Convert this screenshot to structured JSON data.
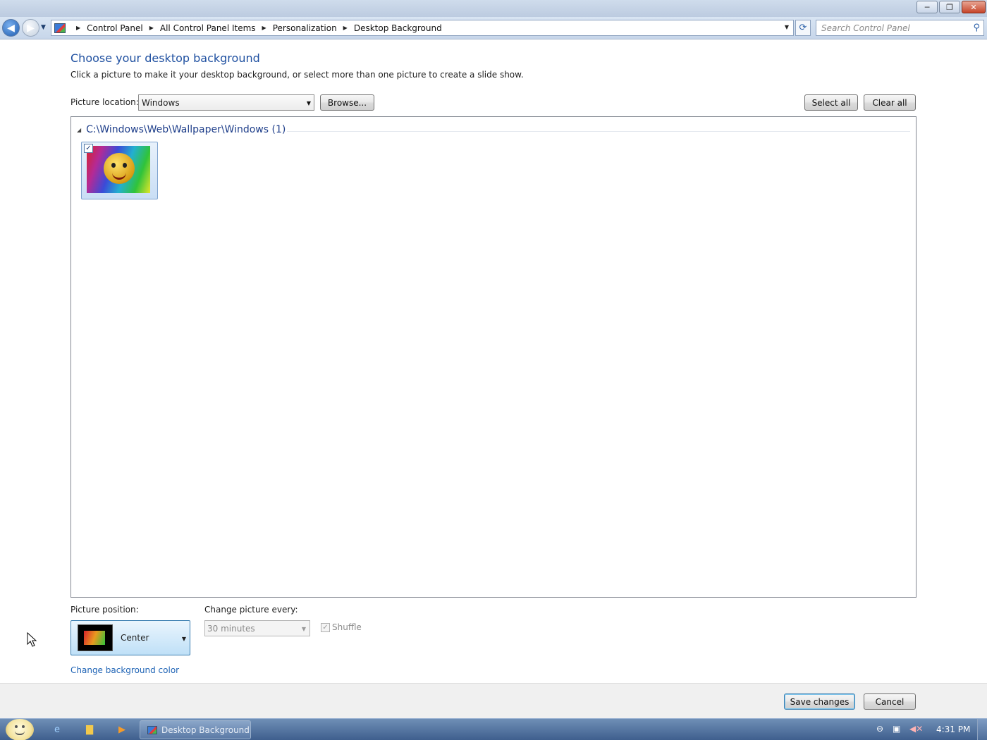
{
  "window": {
    "buttons": {
      "minimize": "─",
      "restore": "❐",
      "close": "✕"
    }
  },
  "nav": {
    "back_glyph": "◀",
    "forward_glyph": "▶",
    "recent_glyph": "▼",
    "breadcrumbs": [
      "Control Panel",
      "All Control Panel Items",
      "Personalization",
      "Desktop Background"
    ],
    "refresh_glyph": "⟳",
    "search_placeholder": "Search Control Panel",
    "search_glyph": "⚲"
  },
  "page": {
    "title": "Choose your desktop background",
    "subtitle": "Click a picture to make it your desktop background, or select more than one picture to create a slide show.",
    "picture_location_label": "Picture location:",
    "picture_location_value": "Windows",
    "browse_button": "Browse...",
    "select_all_button": "Select all",
    "clear_all_button": "Clear all"
  },
  "gallery": {
    "group_title": "C:\\Windows\\Web\\Wallpaper\\Windows (1)",
    "items": [
      {
        "checked": true,
        "check_glyph": "✓"
      }
    ]
  },
  "options": {
    "position_label": "Picture position:",
    "position_value": "Center",
    "change_label": "Change picture every:",
    "interval_value": "30 minutes",
    "shuffle_label": "Shuffle",
    "shuffle_checked": true,
    "bg_color_link": "Change background color"
  },
  "footer": {
    "save_button": "Save changes",
    "cancel_button": "Cancel"
  },
  "taskbar": {
    "task_label": "Desktop Background",
    "clock": "4:31 PM"
  },
  "colors": {
    "title_blue": "#1e4fa0",
    "link_blue": "#1e63b5",
    "taskbar": "#4f6f9c"
  }
}
